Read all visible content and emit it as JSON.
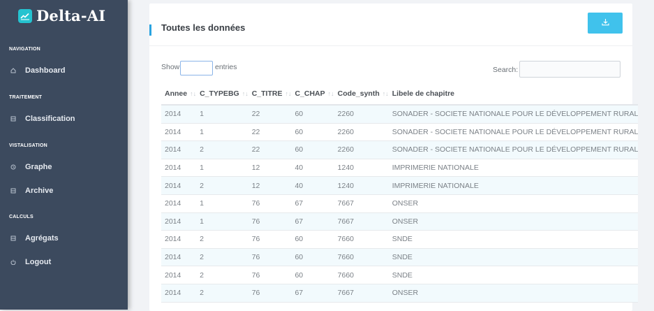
{
  "brand": {
    "name": "Delta-AI",
    "icon": "chart-line-icon"
  },
  "sidebar": {
    "sections": [
      {
        "heading": "NAVIGATION",
        "items": [
          {
            "label": "Dashboard",
            "icon": "home-icon"
          }
        ]
      },
      {
        "heading": "TRAITEMENT",
        "items": [
          {
            "label": "Classification",
            "icon": "grid-icon"
          }
        ]
      },
      {
        "heading": "VISTALISATION",
        "items": [
          {
            "label": "Graphe",
            "icon": "clock-icon"
          },
          {
            "label": "Archive",
            "icon": "grid-icon"
          }
        ]
      },
      {
        "heading": "CALCULS",
        "items": [
          {
            "label": "Agrégats",
            "icon": "grid-icon"
          },
          {
            "label": "Logout",
            "icon": "power-icon"
          }
        ]
      }
    ]
  },
  "main": {
    "title": "Toutes les données",
    "download_icon": "download-icon",
    "accent_color": "#40c2ec",
    "show_label": "Show",
    "entries_label": "entries",
    "search_label": "Search:",
    "table": {
      "columns": [
        "Annee",
        "C_TYPEBG",
        "C_TITRE",
        "C_CHAP",
        "Code_synth",
        "Libele de chapitre"
      ],
      "rows": [
        [
          "2014",
          "1",
          "22",
          "60",
          "2260",
          "SONADER - SOCIETE NATIONALE POUR LE DÉVELOPPEMENT RURAL"
        ],
        [
          "2014",
          "1",
          "22",
          "60",
          "2260",
          "SONADER - SOCIETE NATIONALE POUR LE DÉVELOPPEMENT RURAL"
        ],
        [
          "2014",
          "2",
          "22",
          "60",
          "2260",
          "SONADER - SOCIETE NATIONALE POUR LE DÉVELOPPEMENT RURAL"
        ],
        [
          "2014",
          "1",
          "12",
          "40",
          "1240",
          "IMPRIMERIE NATIONALE"
        ],
        [
          "2014",
          "2",
          "12",
          "40",
          "1240",
          "IMPRIMERIE NATIONALE"
        ],
        [
          "2014",
          "1",
          "76",
          "67",
          "7667",
          "ONSER"
        ],
        [
          "2014",
          "1",
          "76",
          "67",
          "7667",
          "ONSER"
        ],
        [
          "2014",
          "2",
          "76",
          "60",
          "7660",
          "SNDE"
        ],
        [
          "2014",
          "2",
          "76",
          "60",
          "7660",
          "SNDE"
        ],
        [
          "2014",
          "2",
          "76",
          "60",
          "7660",
          "SNDE"
        ],
        [
          "2014",
          "2",
          "76",
          "67",
          "7667",
          "ONSER"
        ]
      ]
    }
  }
}
